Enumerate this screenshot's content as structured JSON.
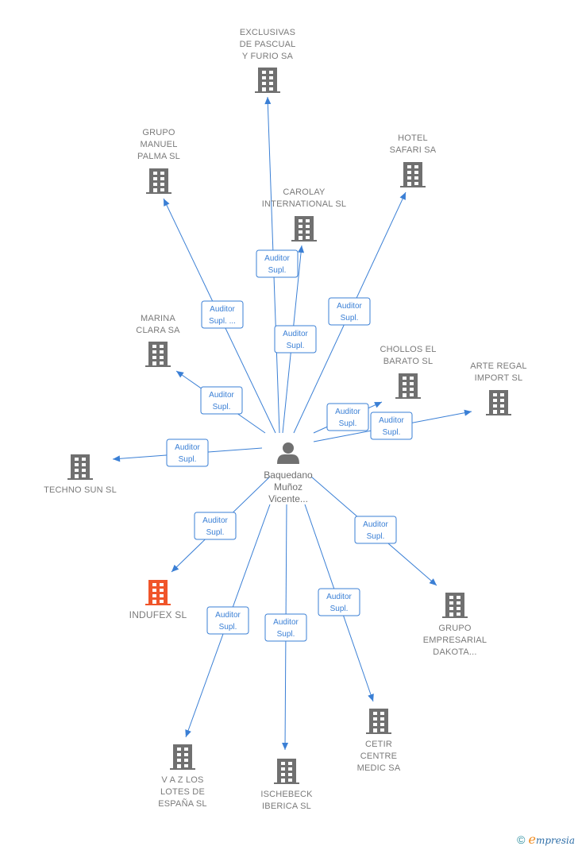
{
  "colors": {
    "edge": "#3a7fd5",
    "company": "#707070",
    "company_highlight": "#f0552a",
    "person": "#707070",
    "label": "#7a7a7a"
  },
  "center": {
    "name_lines": [
      "Baquedano",
      "Muñoz",
      "Vicente..."
    ],
    "icon": "person-icon"
  },
  "companies": [
    {
      "id": "exclusivas",
      "lines": [
        "EXCLUSIVAS",
        "DE PASCUAL",
        "Y FURIO SA"
      ],
      "highlight": false
    },
    {
      "id": "grupo-manuel",
      "lines": [
        "GRUPO",
        "MANUEL",
        "PALMA SL"
      ],
      "highlight": false
    },
    {
      "id": "carolay",
      "lines": [
        "CAROLAY",
        "INTERNATIONAL SL"
      ],
      "highlight": false
    },
    {
      "id": "hotel-safari",
      "lines": [
        "HOTEL",
        "SAFARI SA"
      ],
      "highlight": false
    },
    {
      "id": "marina-clara",
      "lines": [
        "MARINA",
        "CLARA SA"
      ],
      "highlight": false
    },
    {
      "id": "chollos",
      "lines": [
        "CHOLLOS EL",
        "BARATO SL"
      ],
      "highlight": false
    },
    {
      "id": "arte-regal",
      "lines": [
        "ARTE REGAL",
        "IMPORT SL"
      ],
      "highlight": false
    },
    {
      "id": "techno-sun",
      "lines": [
        "TECHNO SUN SL"
      ],
      "highlight": false
    },
    {
      "id": "indufex",
      "lines": [
        "INDUFEX SL"
      ],
      "highlight": true
    },
    {
      "id": "grupo-dakota",
      "lines": [
        "GRUPO",
        "EMPRESARIAL",
        "DAKOTA..."
      ],
      "highlight": false
    },
    {
      "id": "vaz-los-lotes",
      "lines": [
        "V A Z LOS",
        "LOTES DE",
        "ESPAÑA SL"
      ],
      "highlight": false
    },
    {
      "id": "ischebeck",
      "lines": [
        "ISCHEBECK",
        "IBERICA SL"
      ],
      "highlight": false
    },
    {
      "id": "cetir",
      "lines": [
        "CETIR",
        "CENTRE",
        "MEDIC SA"
      ],
      "highlight": false
    }
  ],
  "edges": [
    {
      "to": "exclusivas",
      "lines": [
        "Auditor",
        "Supl."
      ]
    },
    {
      "to": "grupo-manuel",
      "lines": [
        "Auditor",
        "Supl. ..."
      ]
    },
    {
      "to": "carolay",
      "lines": [
        "Auditor",
        "Supl."
      ]
    },
    {
      "to": "hotel-safari",
      "lines": [
        "Auditor",
        "Supl."
      ]
    },
    {
      "to": "marina-clara",
      "lines": [
        "Auditor",
        "Supl."
      ]
    },
    {
      "to": "chollos",
      "lines": [
        "Auditor",
        "Supl."
      ]
    },
    {
      "to": "arte-regal",
      "lines": [
        "Auditor",
        "Supl."
      ]
    },
    {
      "to": "techno-sun",
      "lines": [
        "Auditor",
        "Supl."
      ]
    },
    {
      "to": "indufex",
      "lines": [
        "Auditor",
        "Supl."
      ]
    },
    {
      "to": "grupo-dakota",
      "lines": [
        "Auditor",
        "Supl."
      ]
    },
    {
      "to": "vaz-los-lotes",
      "lines": [
        "Auditor",
        "Supl."
      ]
    },
    {
      "to": "ischebeck",
      "lines": [
        "Auditor",
        "Supl."
      ]
    },
    {
      "to": "cetir",
      "lines": [
        "Auditor",
        "Supl."
      ]
    }
  ],
  "footer": {
    "copyright_symbol": "©",
    "brand_initial": "e",
    "brand_rest": "mpresia"
  }
}
